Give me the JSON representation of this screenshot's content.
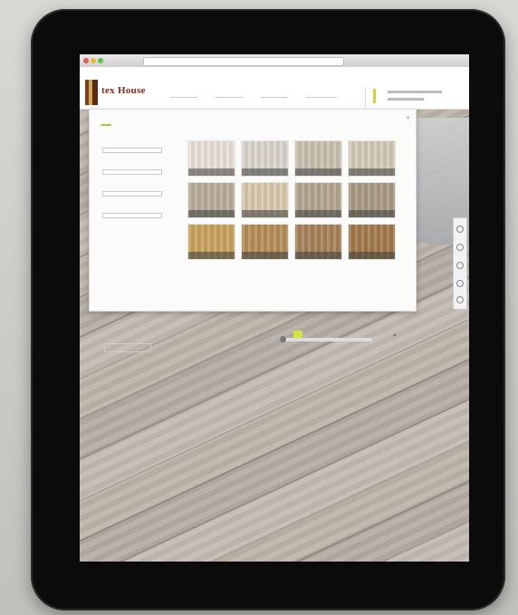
{
  "site": {
    "logo_text": "tex House",
    "nav": [
      "",
      "",
      "",
      ""
    ],
    "header_right_lines": [
      "",
      ""
    ]
  },
  "panel": {
    "tag": "",
    "close_label": "✕",
    "filters": [
      {
        "label": "",
        "value": ""
      },
      {
        "label": "",
        "value": ""
      },
      {
        "label": "",
        "value": ""
      },
      {
        "label": "",
        "value": ""
      }
    ],
    "size_label": "",
    "size_options": "",
    "footer_button": "",
    "footer_note": "",
    "swatches": [
      {
        "color": "#e7e1d8",
        "caption": ""
      },
      {
        "color": "#d9d4cc",
        "caption": ""
      },
      {
        "color": "#cabfae",
        "caption": ""
      },
      {
        "color": "#d3c9b7",
        "caption": ""
      },
      {
        "color": "#b9ad9a",
        "caption": ""
      },
      {
        "color": "#d8c9ad",
        "caption": ""
      },
      {
        "color": "#b4a68f",
        "caption": ""
      },
      {
        "color": "#a99a84",
        "caption": ""
      },
      {
        "color": "#c9a35f",
        "caption": ""
      },
      {
        "color": "#b58e5a",
        "caption": ""
      },
      {
        "color": "#a6825a",
        "caption": ""
      },
      {
        "color": "#a27a4c",
        "caption": ""
      }
    ]
  },
  "colors": {
    "accent_green": "#a9c23a",
    "logo_red": "#8a2a1a",
    "nav_underline": "#4a3d6d"
  }
}
